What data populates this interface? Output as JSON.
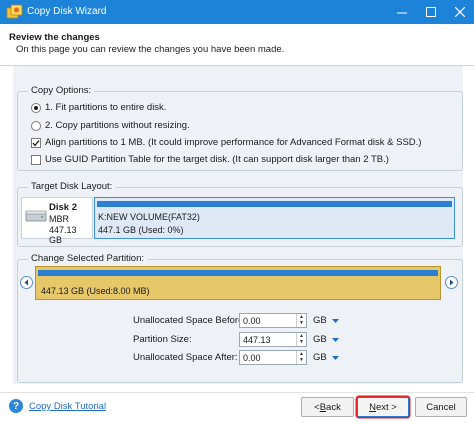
{
  "window": {
    "title": "Copy Disk Wizard",
    "titlebar_color": "#1c83d8",
    "controls": [
      "minimize-icon",
      "maximize-icon",
      "close-icon"
    ]
  },
  "header": {
    "title": "Review the changes",
    "subtitle": "On this page you can review the changes you have been made."
  },
  "copy_options": {
    "legend": "Copy Options:",
    "radio_fit": {
      "label": "1. Fit partitions to entire disk.",
      "selected": true
    },
    "radio_copy": {
      "label": "2. Copy partitions without resizing.",
      "selected": false
    },
    "check_align": {
      "label": "Align partitions to 1 MB.  (It could improve performance for Advanced Format disk & SSD.)",
      "checked": true
    },
    "check_guid": {
      "label": "Use GUID Partition Table for the target disk. (It can support disk larger than 2 TB.)",
      "checked": false
    }
  },
  "target_layout": {
    "legend": "Target Disk Layout:",
    "disk": {
      "name": "Disk 2",
      "type": "MBR",
      "size": "447.13 GB"
    },
    "partition": {
      "label": "K:NEW VOLUME(FAT32)",
      "detail": "447.1 GB (Used: 0%)"
    }
  },
  "change_partition": {
    "legend": "Change Selected Partition:",
    "partition_detail": "447.13 GB (Used:8.00 MB)",
    "fields": [
      {
        "label": "Unallocated Space Before:",
        "value": "0.00",
        "unit": "GB"
      },
      {
        "label": "Partition Size:",
        "value": "447.13",
        "unit": "GB"
      },
      {
        "label": "Unallocated Space After:",
        "value": "0.00",
        "unit": "GB"
      }
    ]
  },
  "footer": {
    "help_link": "Copy Disk Tutorial",
    "back_prefix": "< ",
    "back_hotkey": "B",
    "back_rest": "ack",
    "next_hotkey": "N",
    "next_rest": "ext >",
    "cancel_label": "Cancel"
  },
  "colors": {
    "accent": "#1c83d8",
    "partition_bar": "#2d7fd4",
    "selected_partition": "#e6c86a",
    "next_highlight": "#e02020"
  }
}
